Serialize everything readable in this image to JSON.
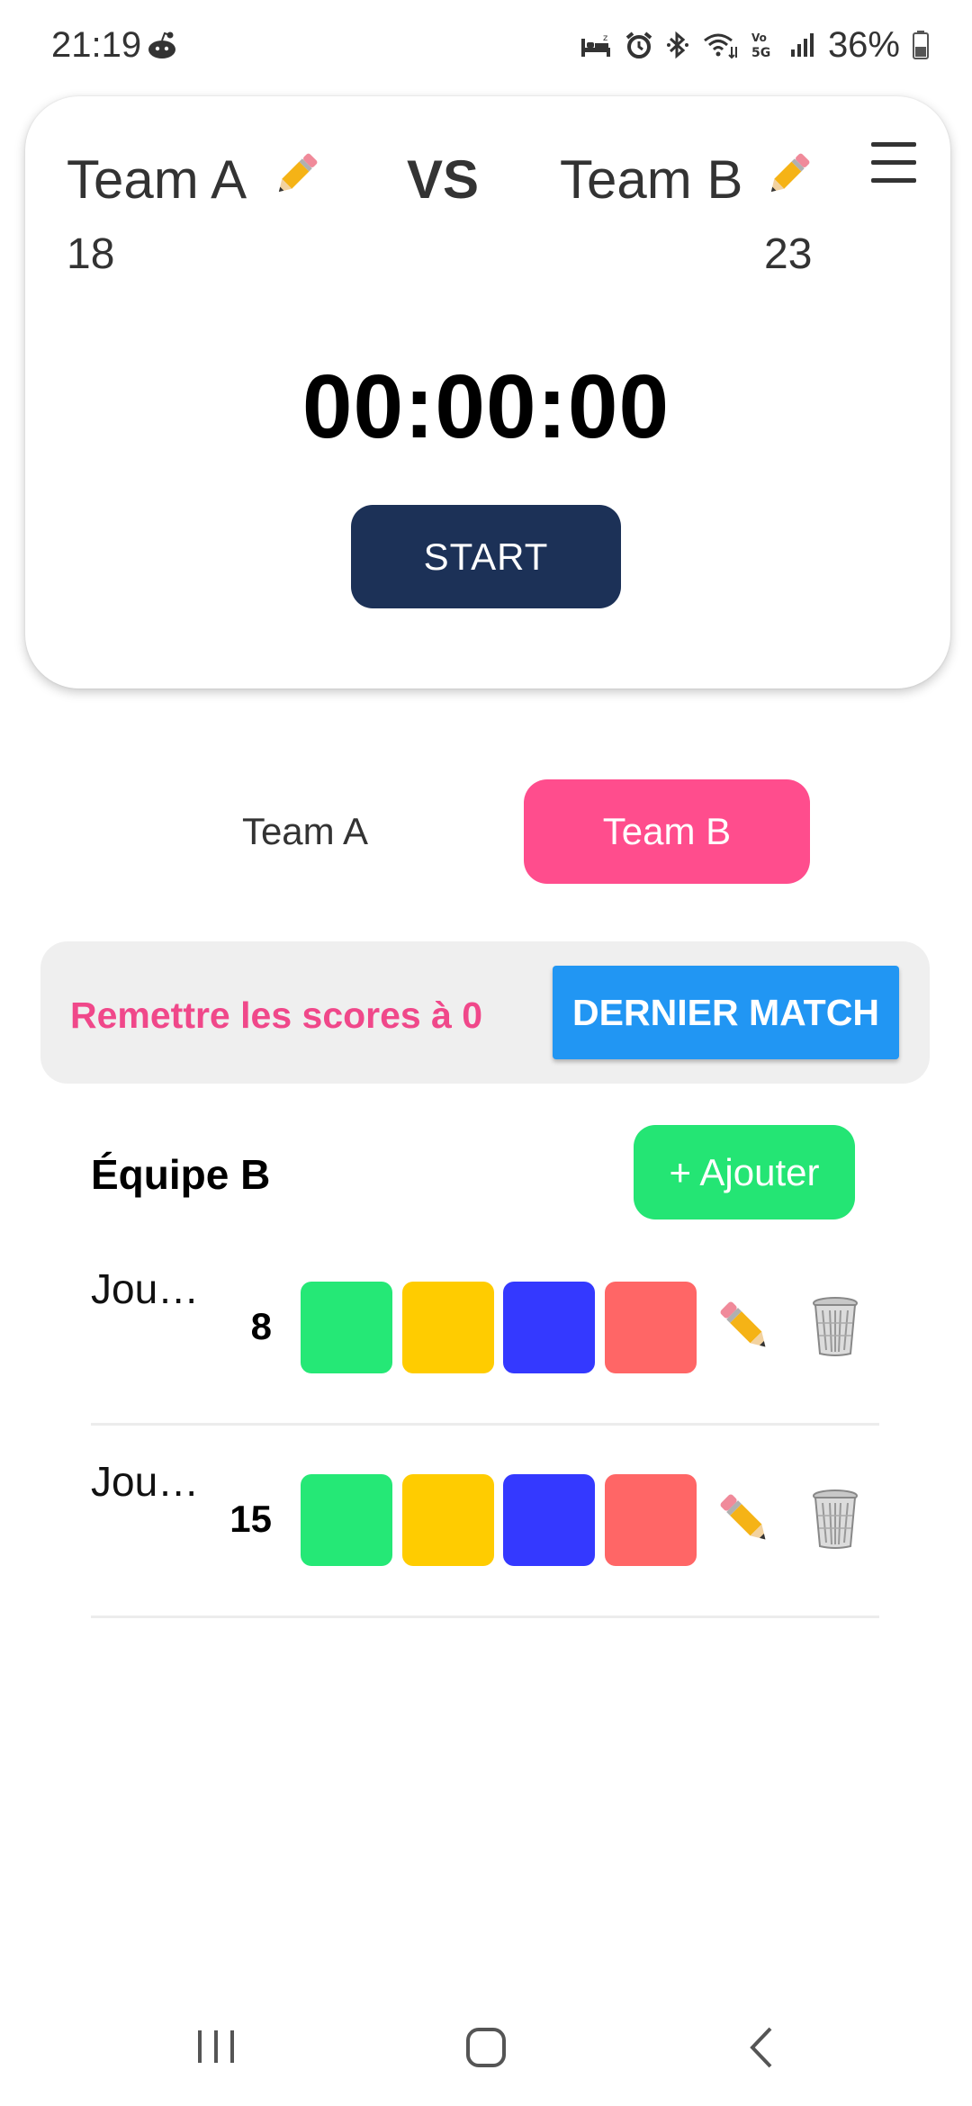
{
  "status_bar": {
    "time": "21:19",
    "left_icon": "reddit-alien-icon",
    "right_icons": [
      "sleep-bed-icon",
      "alarm-icon",
      "bluetooth-icon",
      "wifi-icon",
      "volte-5g-icon",
      "signal-icon"
    ],
    "battery_text": "36%"
  },
  "header": {
    "team_a": {
      "name": "Team A",
      "score": "18"
    },
    "vs_label": "VS",
    "team_b": {
      "name": "Team B",
      "score": "23"
    },
    "timer": "00:00:00",
    "start_label": "START",
    "menu_icon": "hamburger-menu-icon"
  },
  "tabs": [
    {
      "label": "Team A",
      "selected": false
    },
    {
      "label": "Team B",
      "selected": true
    }
  ],
  "actions": {
    "reset_label": "Remettre les scores à 0",
    "last_match_label": "DERNIER MATCH"
  },
  "team_section": {
    "title": "Équipe B",
    "add_label": "+ Ajouter",
    "players": [
      {
        "name": "Jou…",
        "score": "8"
      },
      {
        "name": "Jou…",
        "score": "15"
      }
    ],
    "button_colors": [
      "#25e876",
      "#ffcc00",
      "#3439ff",
      "#ff6666"
    ]
  },
  "colors": {
    "accent_pink": "#ff4d8d",
    "reset_pink": "#f0488a",
    "primary_blue": "#2196f3",
    "start_navy": "#1c3157",
    "add_green": "#24e574"
  },
  "nav_bar": {
    "icons": [
      "recent-apps-icon",
      "home-icon",
      "back-icon"
    ]
  }
}
